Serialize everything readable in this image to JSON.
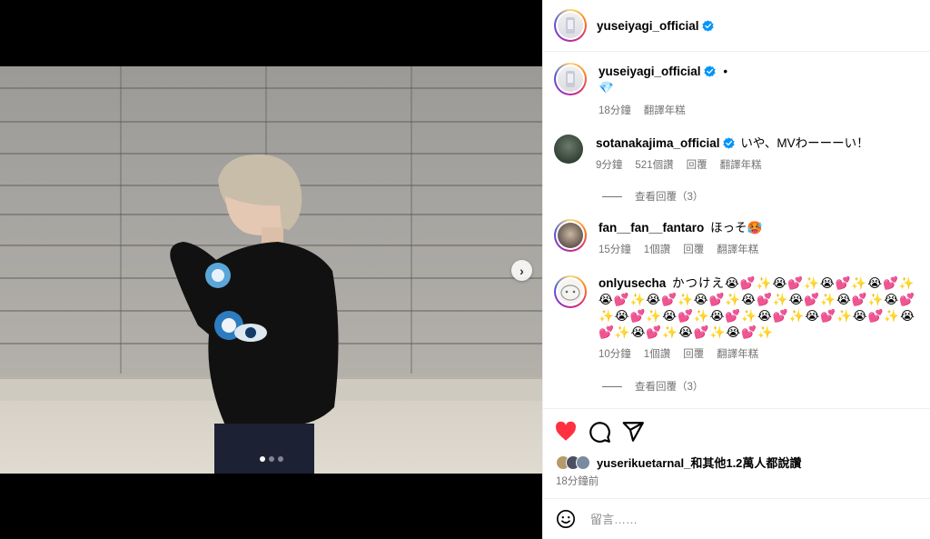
{
  "header": {
    "username": "yuseiyagi_official"
  },
  "caption": {
    "username": "yuseiyagi_official",
    "dot": "•",
    "text": "💎",
    "time": "18分鐘",
    "translate": "翻譯年糕"
  },
  "comments": [
    {
      "username": "sotanakajima_official",
      "verified": true,
      "text": "いや、MVわーーーい！",
      "time": "9分鐘",
      "likes": "521個讚",
      "reply": "回覆",
      "translate": "翻譯年糕",
      "view_replies": "查看回覆（3）"
    },
    {
      "username": "fan__fan__fantaro",
      "verified": false,
      "text": "ほっそ🥵",
      "time": "15分鐘",
      "likes": "1個讚",
      "reply": "回覆",
      "translate": "翻譯年糕"
    },
    {
      "username": "onlyusecha",
      "verified": false,
      "text": "かつけえ😭💕✨😭💕✨😭💕✨😭💕✨😭💕✨😭💕✨😭💕✨😭💕✨😭💕✨😭💕✨😭💕✨😭💕✨😭💕✨😭💕✨😭💕✨😭💕✨😭💕✨😭💕✨😭💕✨😭💕✨😭💕✨",
      "time": "10分鐘",
      "likes": "1個讚",
      "reply": "回覆",
      "translate": "翻譯年糕",
      "view_replies": "查看回覆（3）"
    }
  ],
  "likes": {
    "text": "yuserikuetarnal_和其他1.2萬人都說讚",
    "liked": true
  },
  "post_time": "18分鐘前",
  "comment_input": {
    "placeholder": "留言……"
  },
  "carousel": {
    "arrow": "›",
    "slide_count": 3,
    "active_slide": 1
  },
  "colors": {
    "like_red": "#ff3040",
    "verified_blue": "#0095f6",
    "secondary_text": "#737373"
  }
}
